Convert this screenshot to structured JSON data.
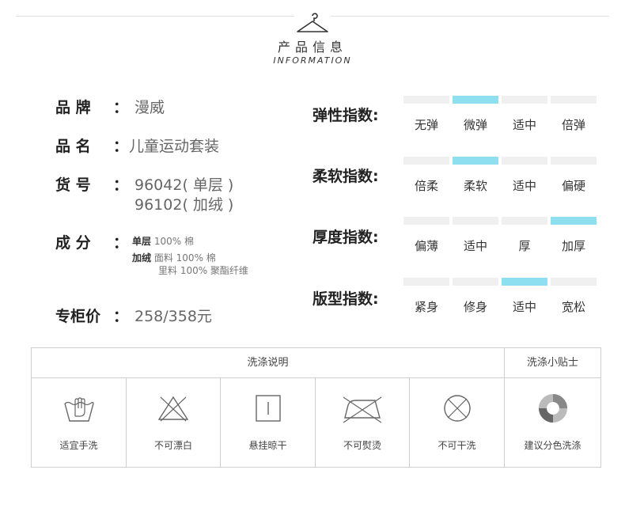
{
  "header": {
    "title_cn": "产品信息",
    "title_en": "INFORMATION"
  },
  "info": {
    "brand_label": "品 牌",
    "brand_value": "漫威",
    "name_label": "品 名",
    "name_value": "儿童运动套装",
    "sku_label": "货 号",
    "sku_value_1": "96042( 单层 )",
    "sku_value_2": "96102( 加绒 )",
    "comp_label": "成 分",
    "comp_line1_tag": "单层",
    "comp_line1_text": "100% 棉",
    "comp_line2_tag": "加绒",
    "comp_line2_text": "面料 100% 棉",
    "comp_line3_text": "里料 100% 聚酯纤维",
    "price_label": "专柜价",
    "price_value": "258/358元",
    "colon": "："
  },
  "indices": [
    {
      "label": "弹性指数:",
      "options": [
        "无弹",
        "微弹",
        "适中",
        "倍弹"
      ],
      "selected": 1
    },
    {
      "label": "柔软指数:",
      "options": [
        "倍柔",
        "柔软",
        "适中",
        "偏硬"
      ],
      "selected": 1
    },
    {
      "label": "厚度指数:",
      "options": [
        "偏薄",
        "适中",
        "厚",
        "加厚"
      ],
      "selected": 3
    },
    {
      "label": "版型指数:",
      "options": [
        "紧身",
        "修身",
        "适中",
        "宽松"
      ],
      "selected": 2
    }
  ],
  "care": {
    "header_main": "洗涤说明",
    "header_tip": "洗涤小贴士",
    "items": [
      {
        "label": "适宜手洗",
        "icon": "hand-wash-icon"
      },
      {
        "label": "不可漂白",
        "icon": "no-bleach-icon"
      },
      {
        "label": "悬挂晾干",
        "icon": "hang-dry-icon"
      },
      {
        "label": "不可熨烫",
        "icon": "no-iron-icon"
      },
      {
        "label": "不可干洗",
        "icon": "no-dry-clean-icon"
      },
      {
        "label": "建议分色洗涤",
        "icon": "color-separate-icon"
      }
    ]
  },
  "colors": {
    "accent": "#8ee0f0",
    "bar_off": "#f0f0f0",
    "border": "#cfcfcf"
  }
}
